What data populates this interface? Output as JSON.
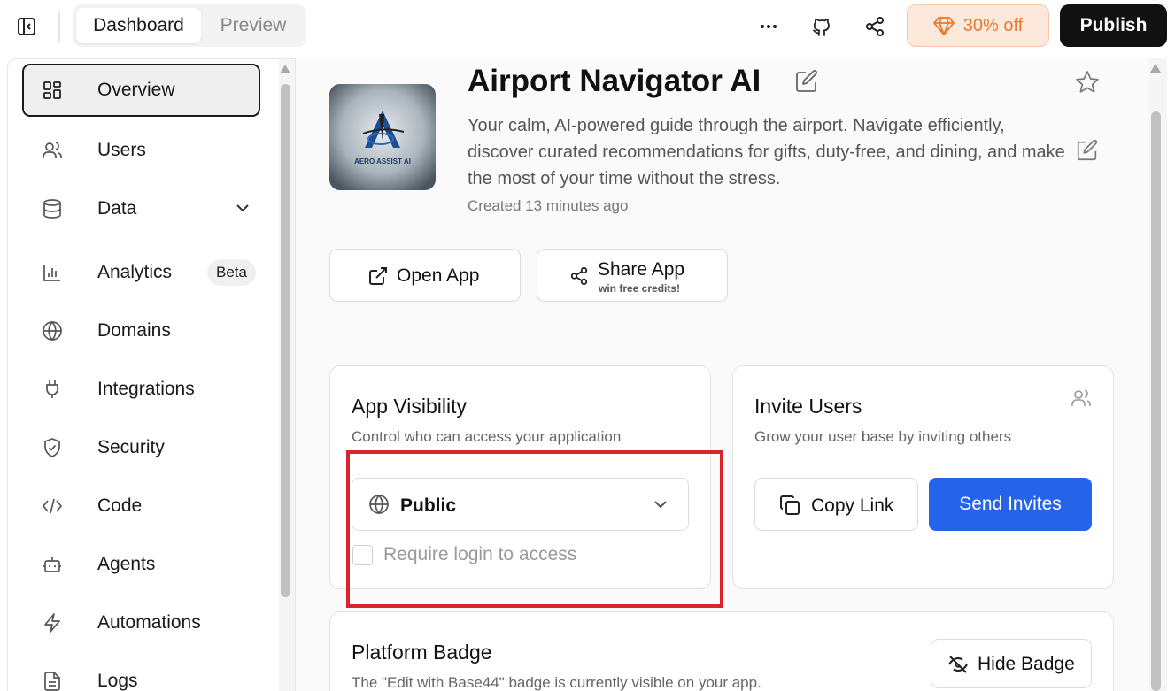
{
  "topbar": {
    "tabs": [
      {
        "label": "Dashboard"
      },
      {
        "label": "Preview"
      }
    ],
    "discount_label": "30% off",
    "publish_label": "Publish",
    "icons": [
      "panel-toggle-icon",
      "more-icon",
      "github-icon",
      "share-icon",
      "gem-icon"
    ]
  },
  "sidebar": {
    "items": [
      {
        "label": "Overview",
        "icon": "grid-icon",
        "active": true
      },
      {
        "label": "Users",
        "icon": "users-icon"
      },
      {
        "label": "Data",
        "icon": "database-icon",
        "expandable": true
      },
      {
        "label": "Analytics",
        "icon": "bar-chart-icon",
        "badge": "Beta"
      },
      {
        "label": "Domains",
        "icon": "globe-icon"
      },
      {
        "label": "Integrations",
        "icon": "plug-icon"
      },
      {
        "label": "Security",
        "icon": "shield-icon"
      },
      {
        "label": "Code",
        "icon": "code-icon"
      },
      {
        "label": "Agents",
        "icon": "bot-icon"
      },
      {
        "label": "Automations",
        "icon": "lightning-icon"
      },
      {
        "label": "Logs",
        "icon": "file-icon"
      }
    ]
  },
  "app": {
    "title": "Airport Navigator AI",
    "description": "Your calm, AI-powered guide through the airport. Navigate efficiently, discover curated recommendations for gifts, duty-free, and dining, and make the most of your time without the stress.",
    "created": "Created 13 minutes ago",
    "logo_text": "AERO ASSIST AI",
    "open_label": "Open App",
    "share_label": "Share App",
    "share_sub": "win free credits!"
  },
  "visibility": {
    "title": "App Visibility",
    "subtitle": "Control who can access your application",
    "selected": "Public",
    "require_login_label": "Require login to access",
    "require_login_checked": false
  },
  "invite": {
    "title": "Invite Users",
    "subtitle": "Grow your user base by inviting others",
    "copy_label": "Copy Link",
    "send_label": "Send Invites"
  },
  "badge": {
    "title": "Platform Badge",
    "subtitle": "The \"Edit with Base44\" badge is currently visible on your app.",
    "hide_label": "Hide Badge"
  },
  "colors": {
    "primary": "#2563eb",
    "publish": "#111111",
    "discount_bg": "#fde9dc",
    "discount_text": "#e87a2e",
    "highlight": "#d9242b"
  }
}
